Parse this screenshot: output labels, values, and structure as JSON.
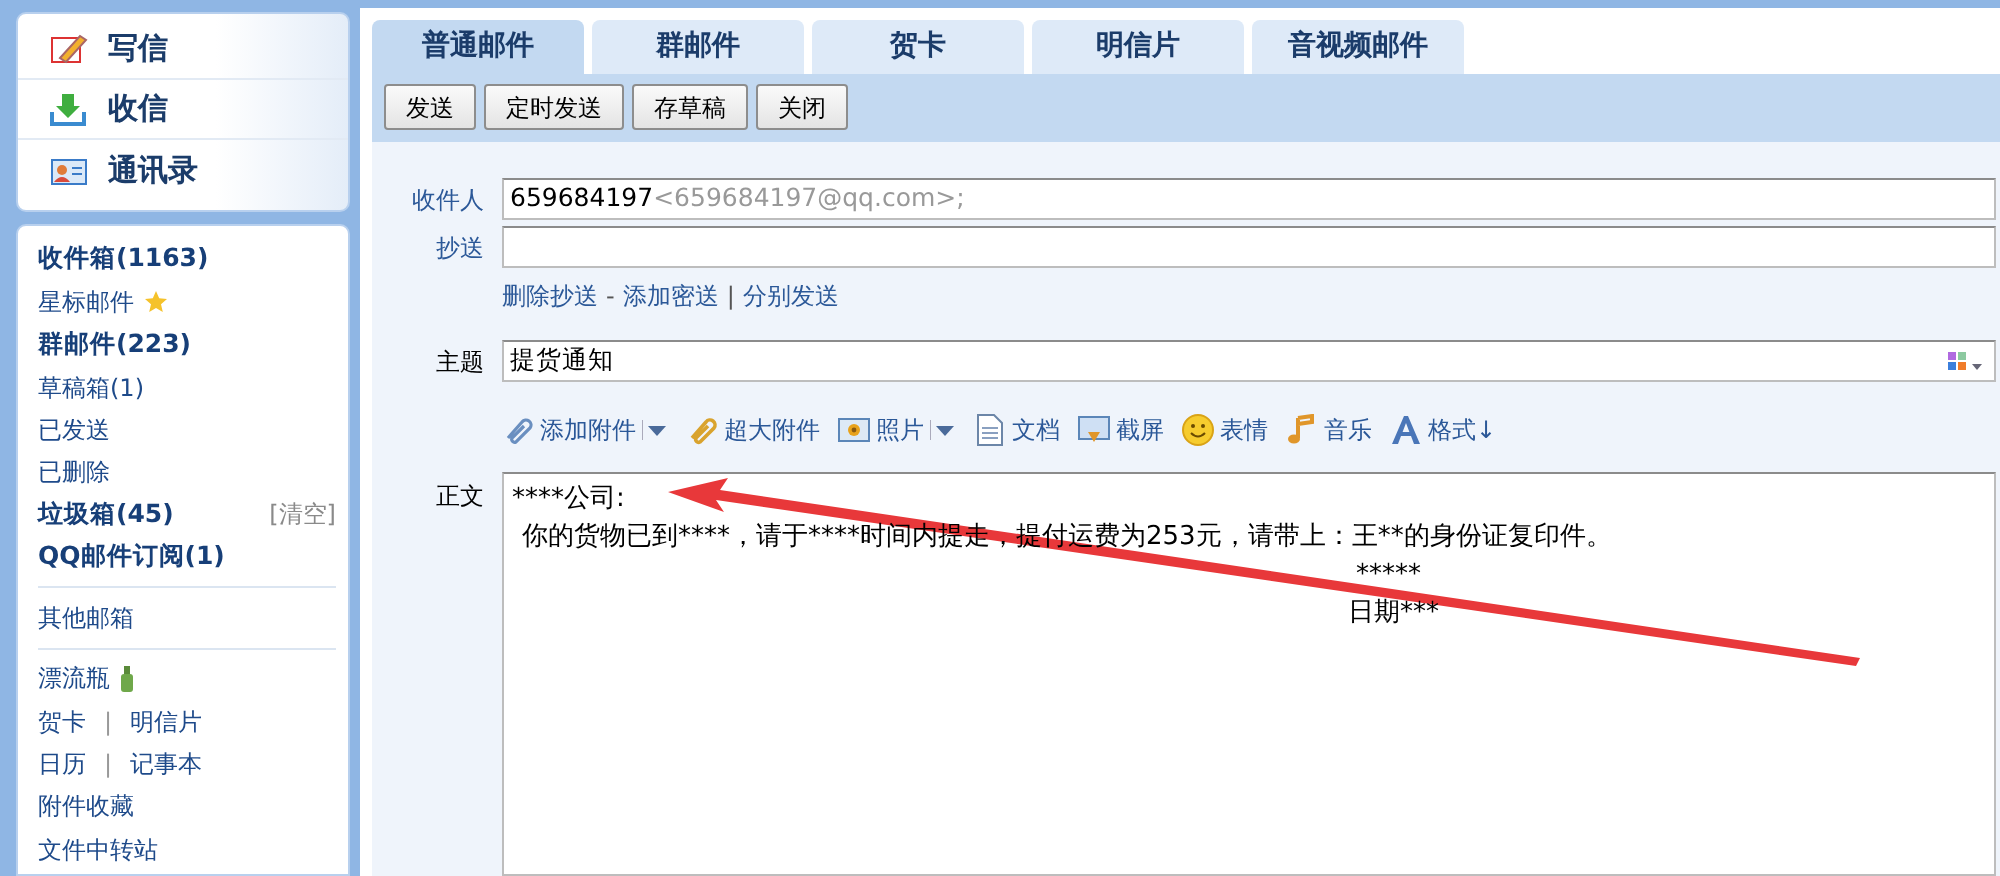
{
  "sidebar": {
    "actions": [
      {
        "label": "写信",
        "kind": "compose"
      },
      {
        "label": "收信",
        "kind": "inbox"
      },
      {
        "label": "通讯录",
        "kind": "contacts"
      }
    ],
    "folder_groups": [
      [
        {
          "kind": "folder",
          "label": "收件箱(1163)",
          "bold": true
        },
        {
          "kind": "starred",
          "label": "星标邮件",
          "bold": false
        },
        {
          "kind": "folder",
          "label": "群邮件(223)",
          "bold": true
        },
        {
          "kind": "folder",
          "label": "草稿箱(1)",
          "bold": false
        },
        {
          "kind": "folder",
          "label": "已发送",
          "bold": false
        },
        {
          "kind": "folder",
          "label": "已删除",
          "bold": false
        },
        {
          "kind": "trash",
          "label": "垃圾箱(45)",
          "bold": true,
          "action": "[清空]"
        },
        {
          "kind": "folder",
          "label": "QQ邮件订阅(1)",
          "bold": true
        }
      ],
      [
        {
          "kind": "folder",
          "label": "其他邮箱",
          "bold": false
        }
      ],
      [
        {
          "kind": "bottle",
          "label": "漂流瓶",
          "bold": false
        },
        {
          "kind": "pair",
          "labels": [
            "贺卡",
            "明信片"
          ],
          "separator": "|"
        },
        {
          "kind": "pair",
          "labels": [
            "日历",
            "记事本"
          ],
          "separator": "|"
        },
        {
          "kind": "folder",
          "label": "附件收藏",
          "bold": false
        },
        {
          "kind": "folder",
          "label": "文件中转站",
          "bold": false
        }
      ]
    ]
  },
  "tabs": [
    {
      "label": "普通邮件",
      "selected": true
    },
    {
      "label": "群邮件",
      "selected": false
    },
    {
      "label": "贺卡",
      "selected": false
    },
    {
      "label": "明信片",
      "selected": false
    },
    {
      "label": "音视频邮件",
      "selected": false
    }
  ],
  "buttons": [
    "发送",
    "定时发送",
    "存草稿",
    "关闭"
  ],
  "form": {
    "to_label": "收件人",
    "to_name": "659684197",
    "to_address": "<659684197@qq.com>;",
    "cc_label": "抄送",
    "cc_links": [
      {
        "label": "删除抄送"
      },
      {
        "separator": "-",
        "label": "添加密送"
      },
      {
        "separator": "|",
        "label": "分别发送"
      }
    ],
    "subject_label": "主题",
    "subject": "提货通知",
    "tools": [
      {
        "kind": "clip",
        "label": "添加附件",
        "dropdown": true
      },
      {
        "kind": "bigclip",
        "label": "超大附件",
        "dropdown": false
      },
      {
        "kind": "photo",
        "label": "照片",
        "dropdown": true
      },
      {
        "kind": "doc",
        "label": "文档",
        "dropdown": false
      },
      {
        "kind": "screen",
        "label": "截屏",
        "dropdown": false
      },
      {
        "kind": "smile",
        "label": "表情",
        "dropdown": false
      },
      {
        "kind": "music",
        "label": "音乐",
        "dropdown": false
      },
      {
        "kind": "font",
        "label": "格式↓",
        "dropdown": false
      }
    ],
    "body_label": "正文",
    "body_lines": [
      {
        "text": "****公司:",
        "kind": "greeting"
      },
      {
        "text": "你的货物已到****，请于****时间内提走，提付运费为253元，请带上：王**的身份证复印件。",
        "kind": "paragraph"
      },
      {
        "text": "*****",
        "kind": "signature"
      },
      {
        "text": "日期***",
        "kind": "date"
      }
    ]
  }
}
